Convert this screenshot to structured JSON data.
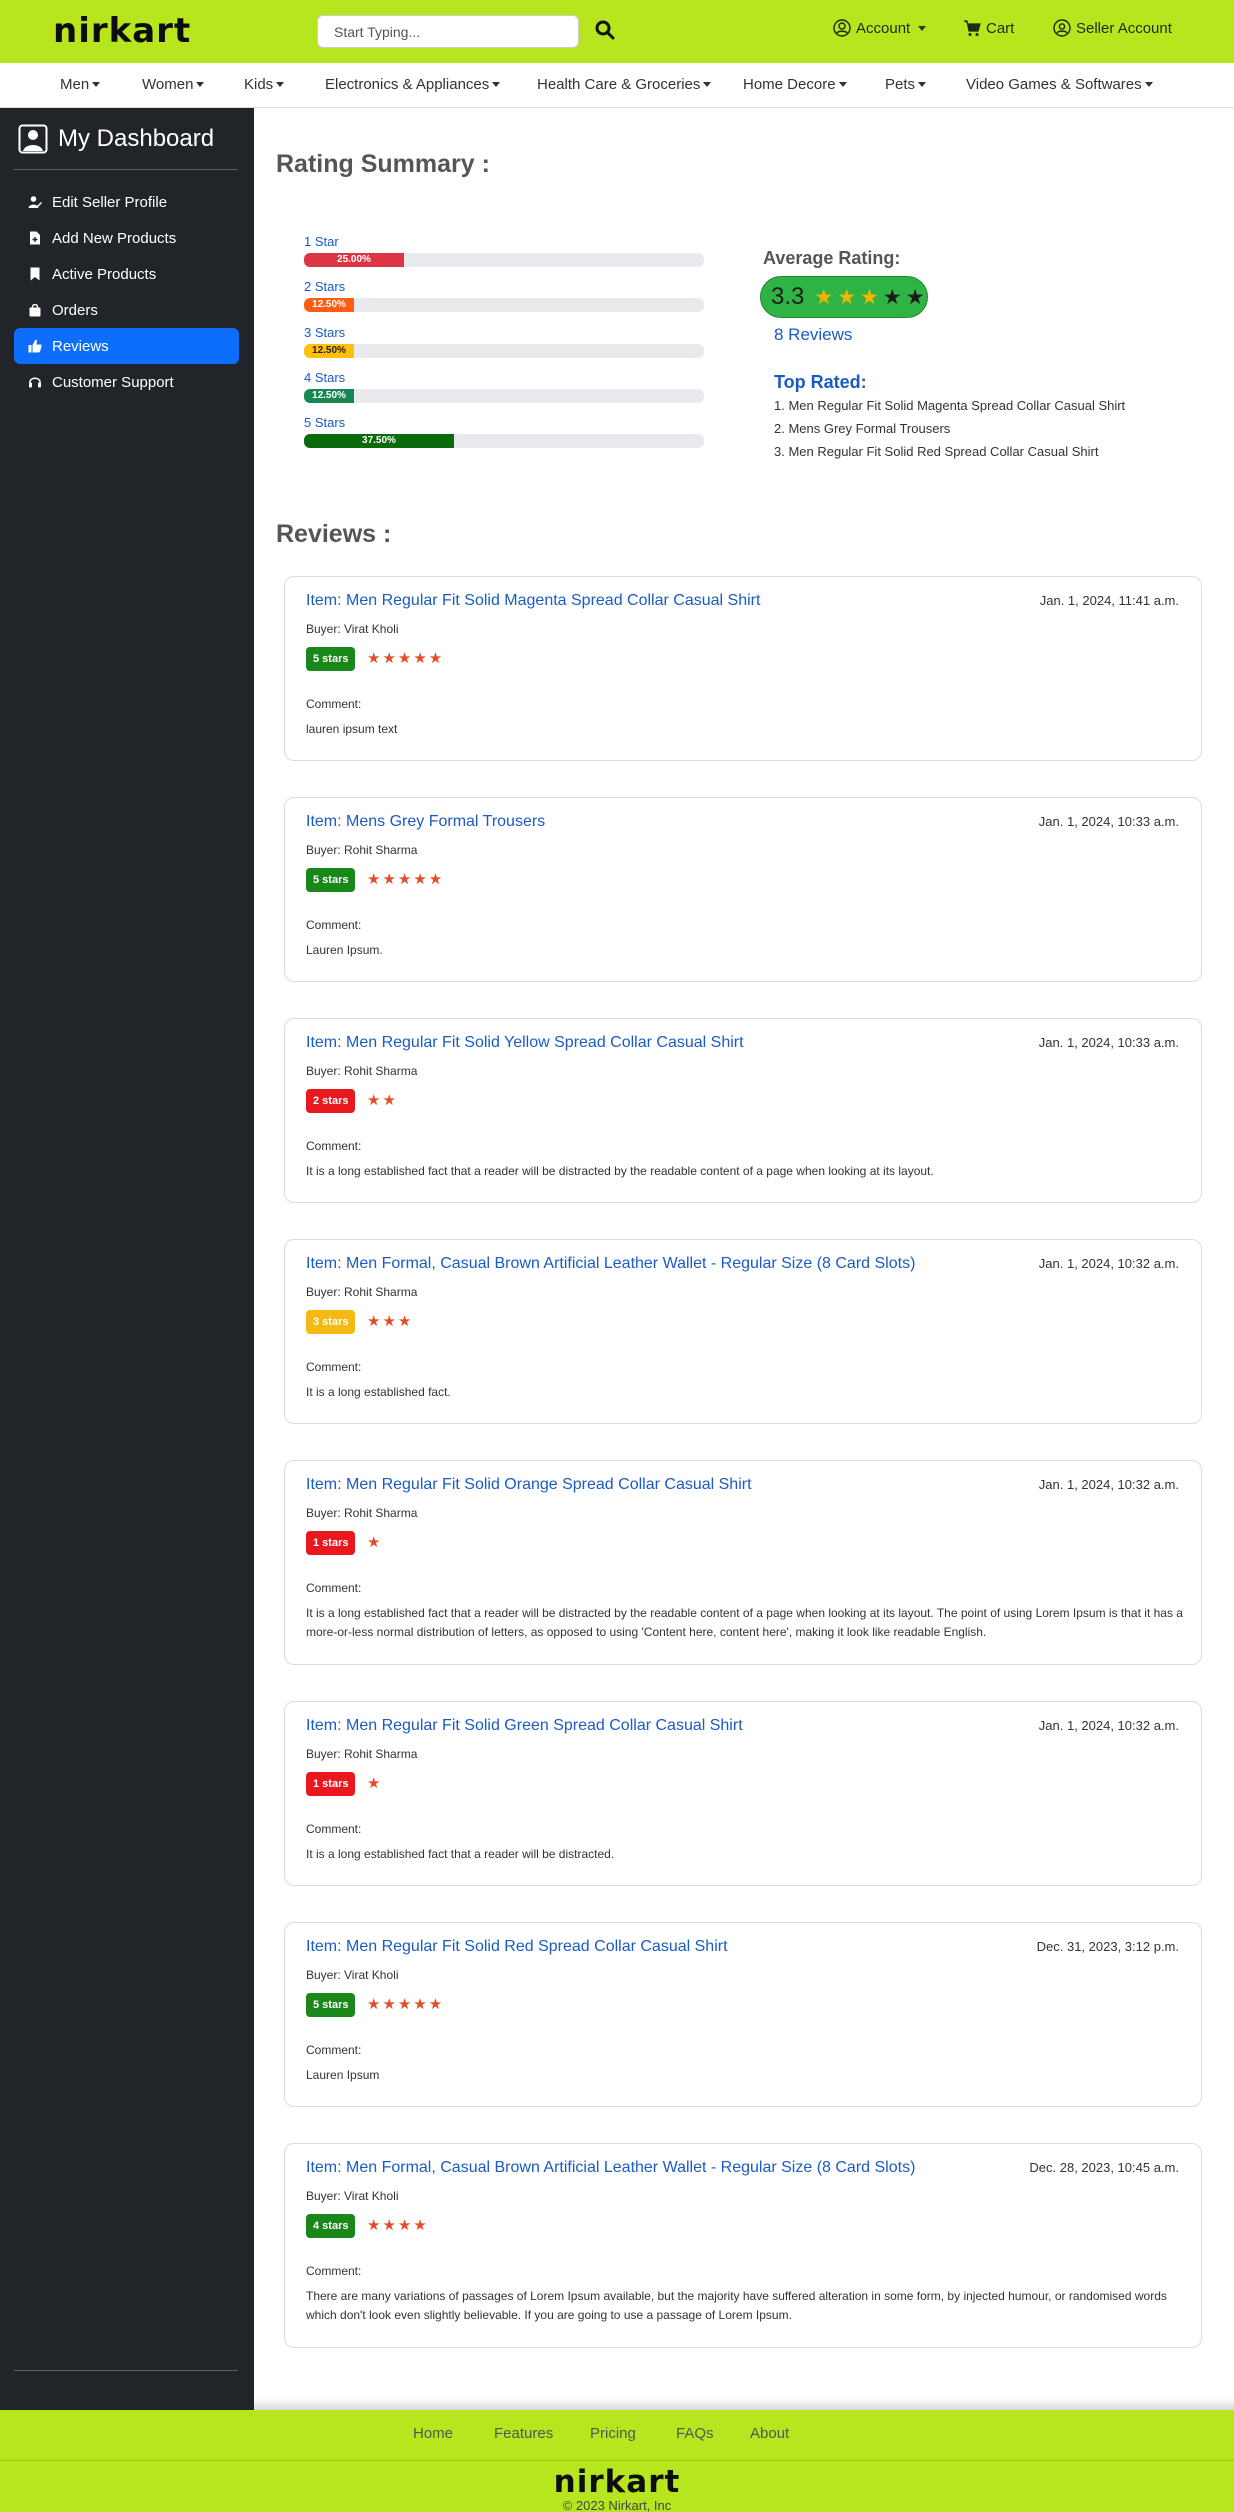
{
  "header": {
    "logo": "nirkart",
    "search_placeholder": "Start Typing...",
    "account_label": "Account",
    "cart_label": "Cart",
    "seller_label": "Seller Account"
  },
  "categories": [
    "Men",
    "Women",
    "Kids",
    "Electronics & Appliances",
    "Health Care & Groceries",
    "Home Decore",
    "Pets",
    "Video Games & Softwares"
  ],
  "sidebar": {
    "title": "My Dashboard",
    "items": [
      {
        "label": "Edit Seller Profile",
        "icon": "user-edit-icon"
      },
      {
        "label": "Add New Products",
        "icon": "file-plus-icon"
      },
      {
        "label": "Active Products",
        "icon": "bookmark-icon"
      },
      {
        "label": "Orders",
        "icon": "bag-icon"
      },
      {
        "label": "Reviews",
        "icon": "thumbs-up-icon",
        "active": true
      },
      {
        "label": "Customer Support",
        "icon": "headset-icon"
      }
    ]
  },
  "rating_summary": {
    "title": "Rating Summary :",
    "rows": [
      {
        "label": "1 Star",
        "percent_text": "25.00%",
        "value": 25.0,
        "color": "#dc3545"
      },
      {
        "label": "2 Stars",
        "percent_text": "12.50%",
        "value": 12.5,
        "color": "#fd5e14"
      },
      {
        "label": "3 Stars",
        "percent_text": "12.50%",
        "value": 12.5,
        "color": "#ffc107"
      },
      {
        "label": "4 Stars",
        "percent_text": "12.50%",
        "value": 12.5,
        "color": "#198754"
      },
      {
        "label": "5 Stars",
        "percent_text": "37.50%",
        "value": 37.5,
        "color": "#0b6b0b"
      }
    ],
    "average_label": "Average Rating:",
    "average_value": "3.3",
    "average_stars": 3,
    "reviews_count_text": "8 Reviews",
    "top_rated_title": "Top Rated:",
    "top_rated": [
      "1. Men Regular Fit Solid Magenta Spread Collar Casual Shirt",
      "2. Mens Grey Formal Trousers",
      "3. Men Regular Fit Solid Red Spread Collar Casual Shirt"
    ]
  },
  "reviews": {
    "title": "Reviews :",
    "comment_label": "Comment:",
    "items": [
      {
        "item": "Item: Men Regular Fit Solid Magenta Spread Collar Casual Shirt",
        "date": "Jan. 1, 2024, 11:41 a.m.",
        "buyer": "Buyer: Virat Kholi",
        "badge": "5 stars",
        "stars": 5,
        "badge_color": "#198719",
        "comment": "lauren ipsum text"
      },
      {
        "item": "Item: Mens Grey Formal Trousers",
        "date": "Jan. 1, 2024, 10:33 a.m.",
        "buyer": "Buyer: Rohit Sharma",
        "badge": "5 stars",
        "stars": 5,
        "badge_color": "#198719",
        "comment": "Lauren Ipsum."
      },
      {
        "item": "Item: Men Regular Fit Solid Yellow Spread Collar Casual Shirt",
        "date": "Jan. 1, 2024, 10:33 a.m.",
        "buyer": "Buyer: Rohit Sharma",
        "badge": "2 stars",
        "stars": 2,
        "badge_color": "#e8181e",
        "comment": "It is a long established fact that a reader will be distracted by the readable content of a page when looking at its layout."
      },
      {
        "item": "Item: Men Formal, Casual Brown Artificial Leather Wallet - Regular Size (8 Card Slots)",
        "date": "Jan. 1, 2024, 10:32 a.m.",
        "buyer": "Buyer: Rohit Sharma",
        "badge": "3 stars",
        "stars": 3,
        "badge_color": "#f5b914",
        "comment": "It is a long established fact."
      },
      {
        "item": "Item: Men Regular Fit Solid Orange Spread Collar Casual Shirt",
        "date": "Jan. 1, 2024, 10:32 a.m.",
        "buyer": "Buyer: Rohit Sharma",
        "badge": "1 stars",
        "stars": 1,
        "badge_color": "#e8181e",
        "comment": "It is a long established fact that a reader will be distracted by the readable content of a page when looking at its layout. The point of using Lorem Ipsum is that it has a more-or-less normal distribution of letters, as opposed to using 'Content here, content here', making it look like readable English."
      },
      {
        "item": "Item: Men Regular Fit Solid Green Spread Collar Casual Shirt",
        "date": "Jan. 1, 2024, 10:32 a.m.",
        "buyer": "Buyer: Rohit Sharma",
        "badge": "1 stars",
        "stars": 1,
        "badge_color": "#e8181e",
        "comment": "It is a long established fact that a reader will be distracted."
      },
      {
        "item": "Item: Men Regular Fit Solid Red Spread Collar Casual Shirt",
        "date": "Dec. 31, 2023, 3:12 p.m.",
        "buyer": "Buyer: Virat Kholi",
        "badge": "5 stars",
        "stars": 5,
        "badge_color": "#198719",
        "comment": "Lauren Ipsum"
      },
      {
        "item": "Item: Men Formal, Casual Brown Artificial Leather Wallet - Regular Size (8 Card Slots)",
        "date": "Dec. 28, 2023, 10:45 a.m.",
        "buyer": "Buyer: Virat Kholi",
        "badge": "4 stars",
        "stars": 4,
        "badge_color": "#198719",
        "comment": "There are many variations of passages of Lorem Ipsum available, but the majority have suffered alteration in some form, by injected humour, or randomised words which don't look even slightly believable. If you are going to use a passage of Lorem Ipsum."
      }
    ]
  },
  "footer": {
    "links": [
      "Home",
      "Features",
      "Pricing",
      "FAQs",
      "About"
    ],
    "logo": "nirkart",
    "copyright": "© 2023 Nirkart, Inc"
  },
  "colors": {
    "brand_green": "#b7e61e",
    "sidebar_dark": "#212529",
    "active_blue": "#0d6efd",
    "link_blue": "#1a5bc4"
  }
}
